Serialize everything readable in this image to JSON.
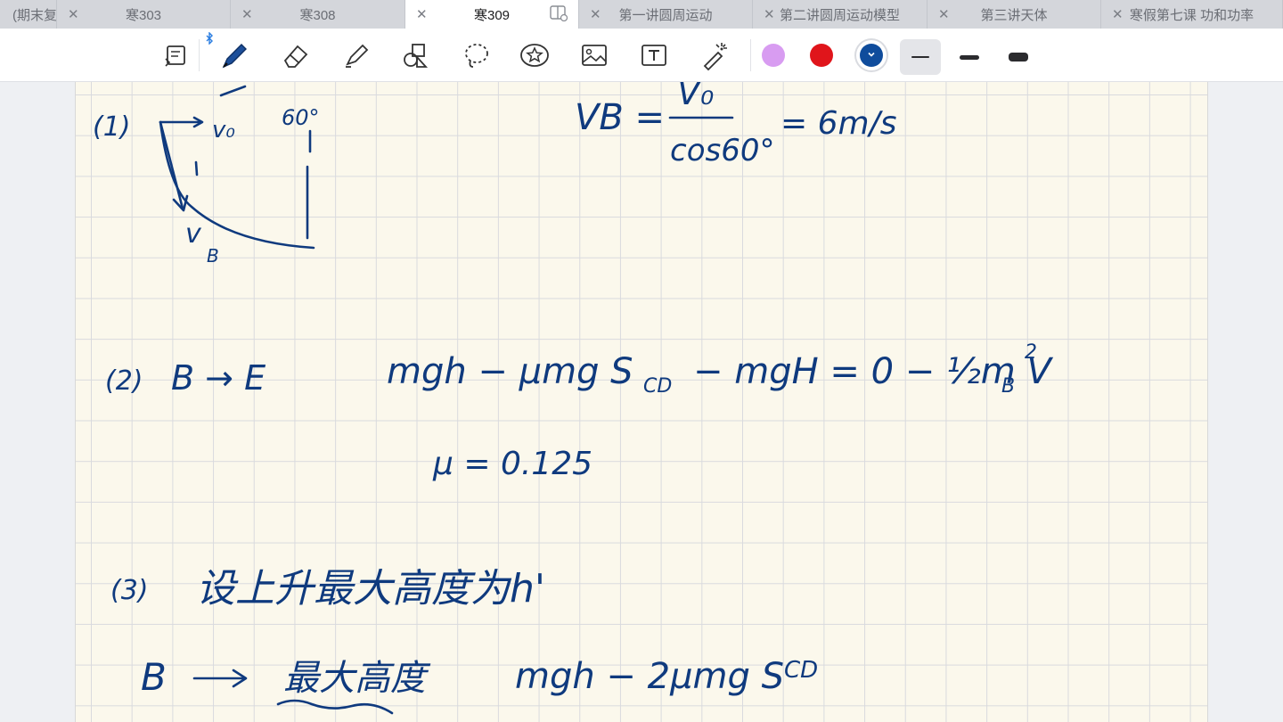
{
  "tabs": [
    {
      "label": "(期末复习) 第一讲",
      "active": false,
      "closable": false
    },
    {
      "label": "寒303",
      "active": false,
      "closable": true
    },
    {
      "label": "寒308",
      "active": false,
      "closable": true
    },
    {
      "label": "寒309",
      "active": true,
      "closable": true
    },
    {
      "label": "第一讲圆周运动",
      "active": false,
      "closable": true
    },
    {
      "label": "第二讲圆周运动模型",
      "active": false,
      "closable": true
    },
    {
      "label": "第三讲天体",
      "active": false,
      "closable": true
    },
    {
      "label": "寒假第七课 功和功率",
      "active": false,
      "closable": true
    }
  ],
  "toolbar": {
    "tools": [
      "page-toggle-icon",
      "pen-icon",
      "eraser-icon",
      "highlighter-icon",
      "shapes-icon",
      "lasso-icon",
      "sticker-icon",
      "image-icon",
      "text-box-icon",
      "laser-pointer-icon"
    ],
    "selected_tool": "pen-icon",
    "bluetooth_indicator": "bluetooth-icon",
    "colors": [
      {
        "name": "violet",
        "hex": "#d89cf1",
        "selected": false
      },
      {
        "name": "red",
        "hex": "#e0151b",
        "selected": false
      },
      {
        "name": "blue",
        "hex": "#0f4c9c",
        "selected": true
      }
    ],
    "thicknesses": [
      "thin",
      "medium",
      "thick"
    ],
    "selected_thickness": "thin"
  },
  "note": {
    "ink_color": "#0f3a7e",
    "paper_color": "#fbf8ec",
    "part1": {
      "label": "(1)",
      "vector_v0": "v₀",
      "angle": "60°",
      "vector_vB": "v",
      "vector_vB_sub": "B",
      "eq_lhs": "VB =",
      "eq_num": "V₀",
      "eq_den": "cos60°",
      "eq_rhs": "= 6m/s"
    },
    "part2": {
      "label": "(2)",
      "path": "B → E",
      "equation": "mgh − μmg S",
      "equation_sub": "CD",
      "equation_rest": "− mgH = 0 − ½m V",
      "equation_rest_sub": "B",
      "equation_rest_sup": "2",
      "result": "μ = 0.125"
    },
    "part3": {
      "label": "(3)",
      "setup": "设上升最大高度为h'",
      "path_from": "B",
      "path_to": "最大高度",
      "equation": "mgh − 2μmg S",
      "equation_sub": "CD"
    }
  }
}
